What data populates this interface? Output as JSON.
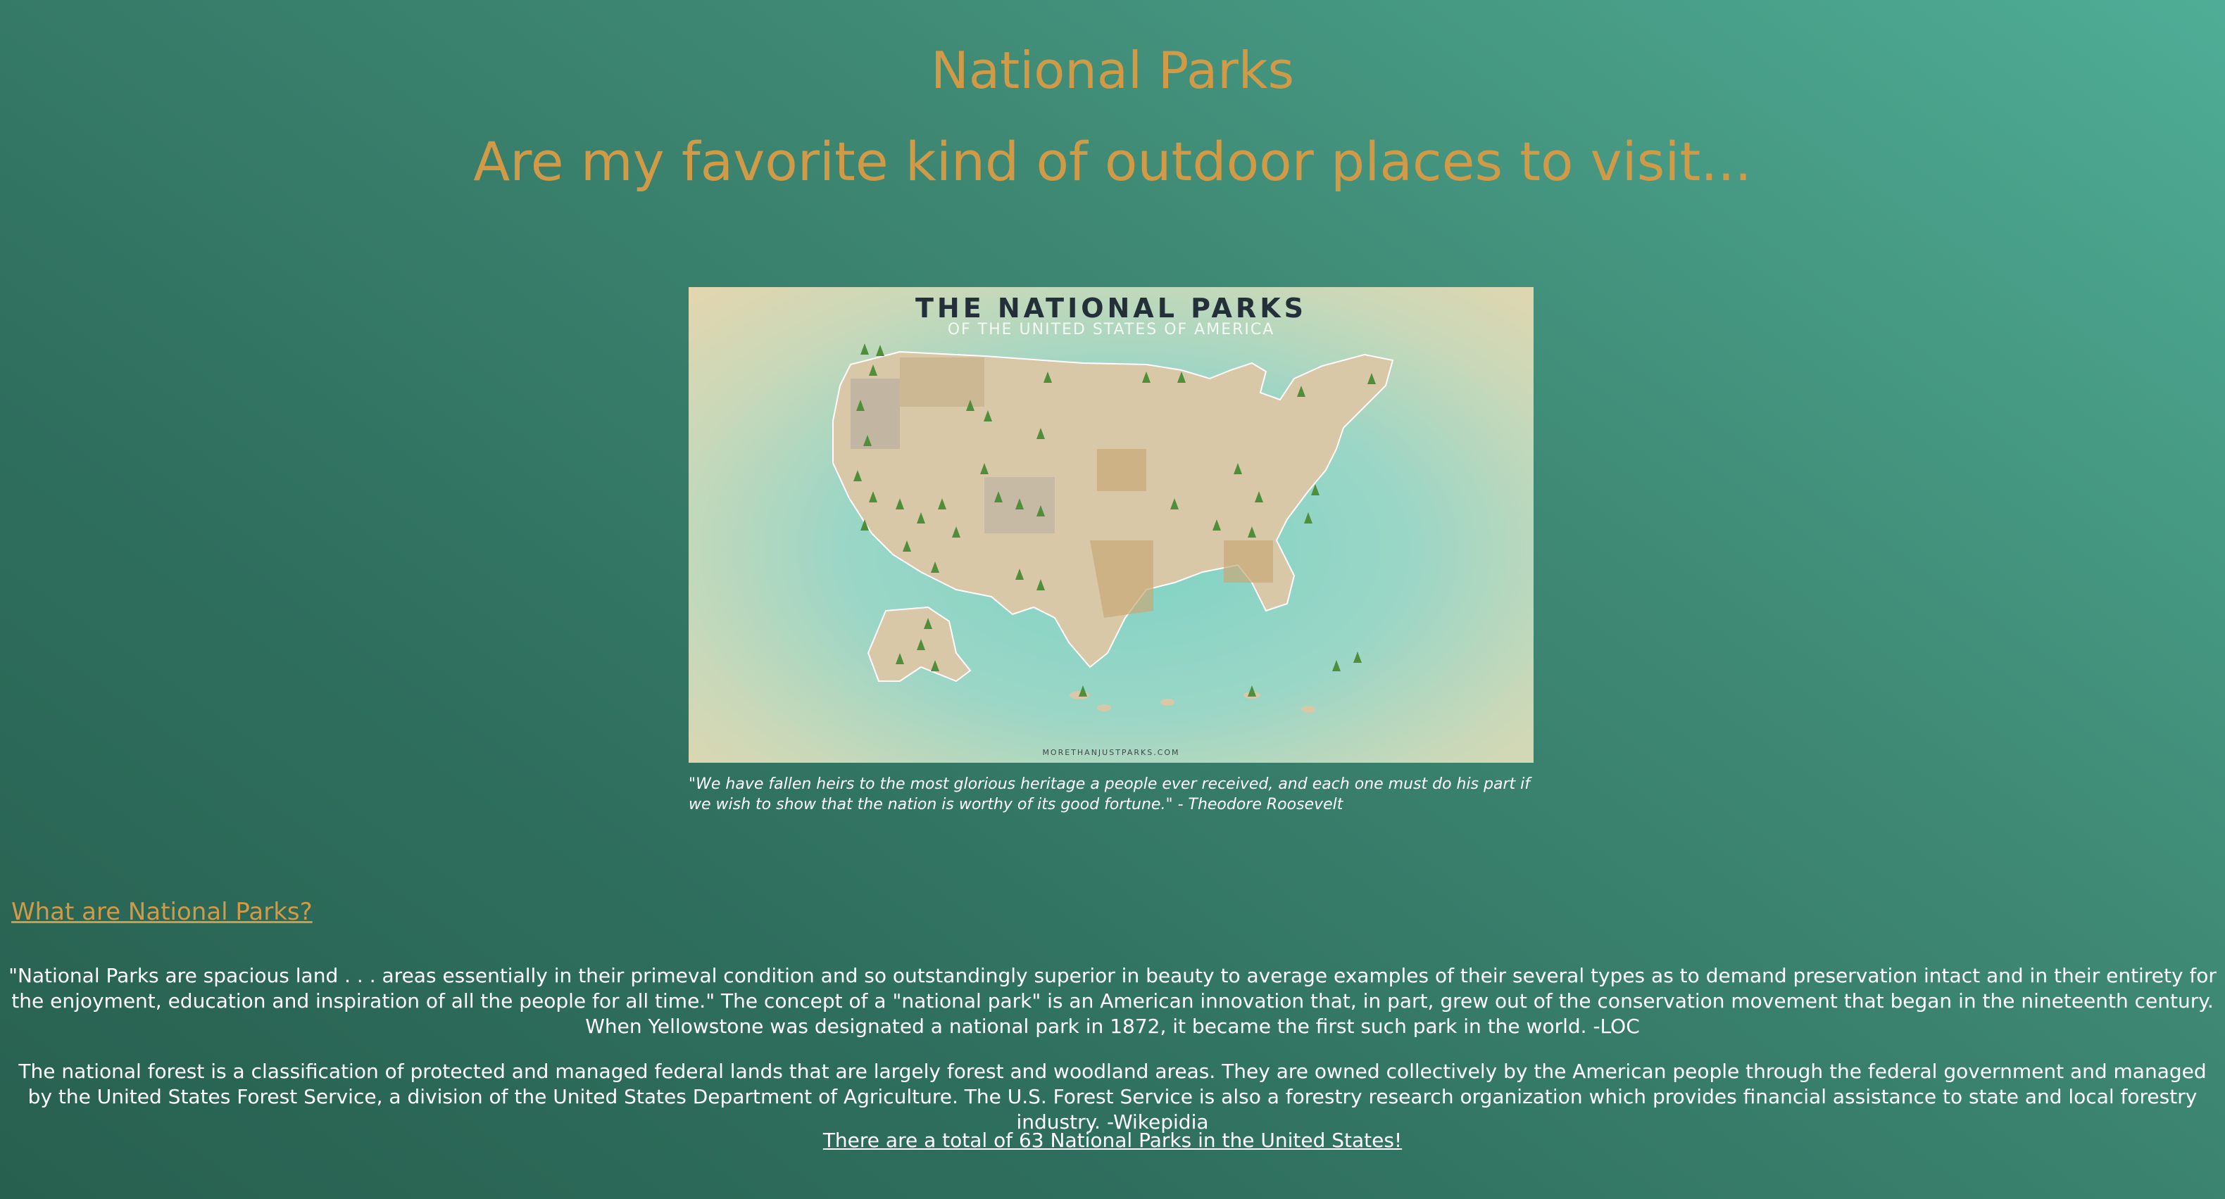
{
  "header": {
    "title": "National Parks",
    "tagline": "Are my favorite kind of outdoor places to visit..."
  },
  "map": {
    "title": "THE NATIONAL PARKS",
    "subtitle": "OF THE UNITED STATES OF AMERICA",
    "credit": "MORETHANJUSTPARKS.COM",
    "quote": "\"We have fallen heirs to the most glorious heritage a people ever received, and each one must do his part if we wish to show that the nation is worthy of its good fortune.\" - Theodore Roosevelt"
  },
  "section": {
    "link_label": "What are National Parks?",
    "paragraph_1": "\"National Parks are spacious land . . . areas essentially in their primeval condition and so outstandingly superior in beauty to average examples of their several types as to demand preservation intact and in their entirety for the enjoyment, education and inspiration of all the people for all time.\" The concept of a \"national park\" is an American innovation that, in part, grew out of the conservation movement that began in the nineteenth century. When Yellowstone was designated a national park in 1872, it became the first such park in the world. -LOC",
    "paragraph_2": "The national forest is a classification of protected and managed federal lands that are largely forest and woodland areas. They are owned collectively by the American people through the federal government and managed by the United States Forest Service, a division of the United States Department of Agriculture. The U.S. Forest Service is also a forestry research organization which provides financial assistance to state and local forestry industry. -Wikepidia",
    "total_link": "There are a total of 63 National Parks in the United States!"
  },
  "colors": {
    "heading": "#d19a47",
    "background_light": "#4fad96",
    "background_dark": "#28604f",
    "text": "#ffffff"
  }
}
